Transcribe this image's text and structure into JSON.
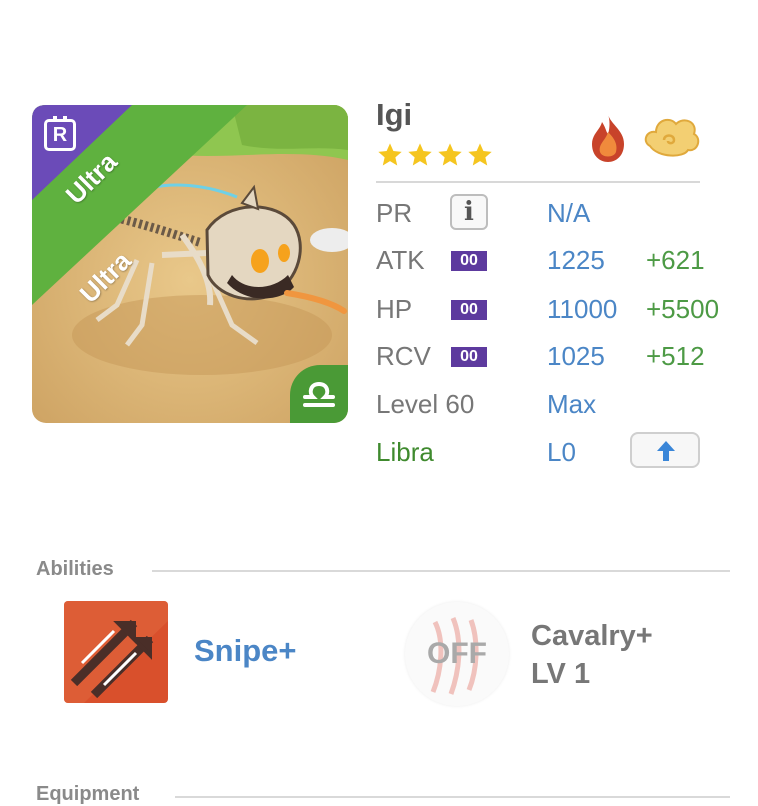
{
  "unit": {
    "name": "Igi",
    "rarity_label": "Ultra",
    "rarity_badge": "R",
    "stars": 4,
    "elements": [
      "fire-element-icon",
      "wind-element-icon"
    ]
  },
  "stats": {
    "pr": {
      "label": "PR",
      "value": "N/A"
    },
    "atk": {
      "label": "ATK",
      "plus": "00",
      "value": "1225",
      "bonus": "+621"
    },
    "hp": {
      "label": "HP",
      "plus": "00",
      "value": "11000",
      "bonus": "+5500"
    },
    "rcv": {
      "label": "RCV",
      "plus": "00",
      "value": "1025",
      "bonus": "+512"
    },
    "level": {
      "label": "Level 60",
      "value": "Max"
    },
    "zodiac": {
      "label": "Libra",
      "value": "L0"
    }
  },
  "abilities": {
    "title": "Abilities",
    "items": [
      {
        "name": "Snipe+",
        "icon": "snipe-arrows-icon"
      },
      {
        "name_line1": "Cavalry+",
        "name_line2": "LV 1",
        "status": "OFF",
        "icon": "claw-marks-icon"
      }
    ]
  },
  "equipment": {
    "title": "Equipment"
  },
  "colors": {
    "accent_blue": "#4b86c6",
    "bonus_green": "#4d9a45",
    "plus_purple": "#5d3a9e",
    "ultra_green": "#5fb13f",
    "rarity_purple": "#6b4bb8",
    "zodiac_green": "#3f8a2e"
  }
}
